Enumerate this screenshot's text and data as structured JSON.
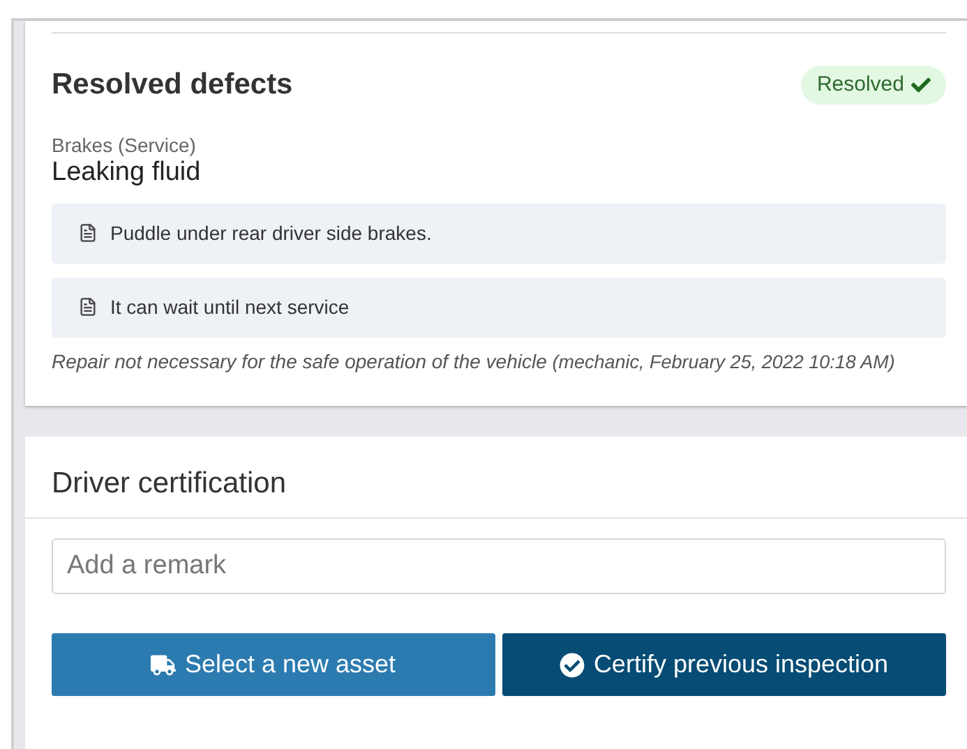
{
  "resolved_section": {
    "title": "Resolved defects",
    "status_badge": {
      "label": "Resolved"
    },
    "defect": {
      "category": "Brakes (Service)",
      "title": "Leaking fluid",
      "notes": [
        "Puddle under rear driver side brakes.",
        "It can wait until next service"
      ],
      "resolution": {
        "text": "Repair not necessary for the safe operation of the vehicle",
        "meta": "(mechanic, February 25, 2022 10:18 AM)"
      }
    }
  },
  "certification": {
    "title": "Driver certification",
    "remark": {
      "placeholder": "Add a remark"
    },
    "buttons": [
      {
        "label": "Select a new asset",
        "kind": "asset"
      },
      {
        "label": "Certify previous inspection",
        "kind": "certify"
      }
    ]
  }
}
